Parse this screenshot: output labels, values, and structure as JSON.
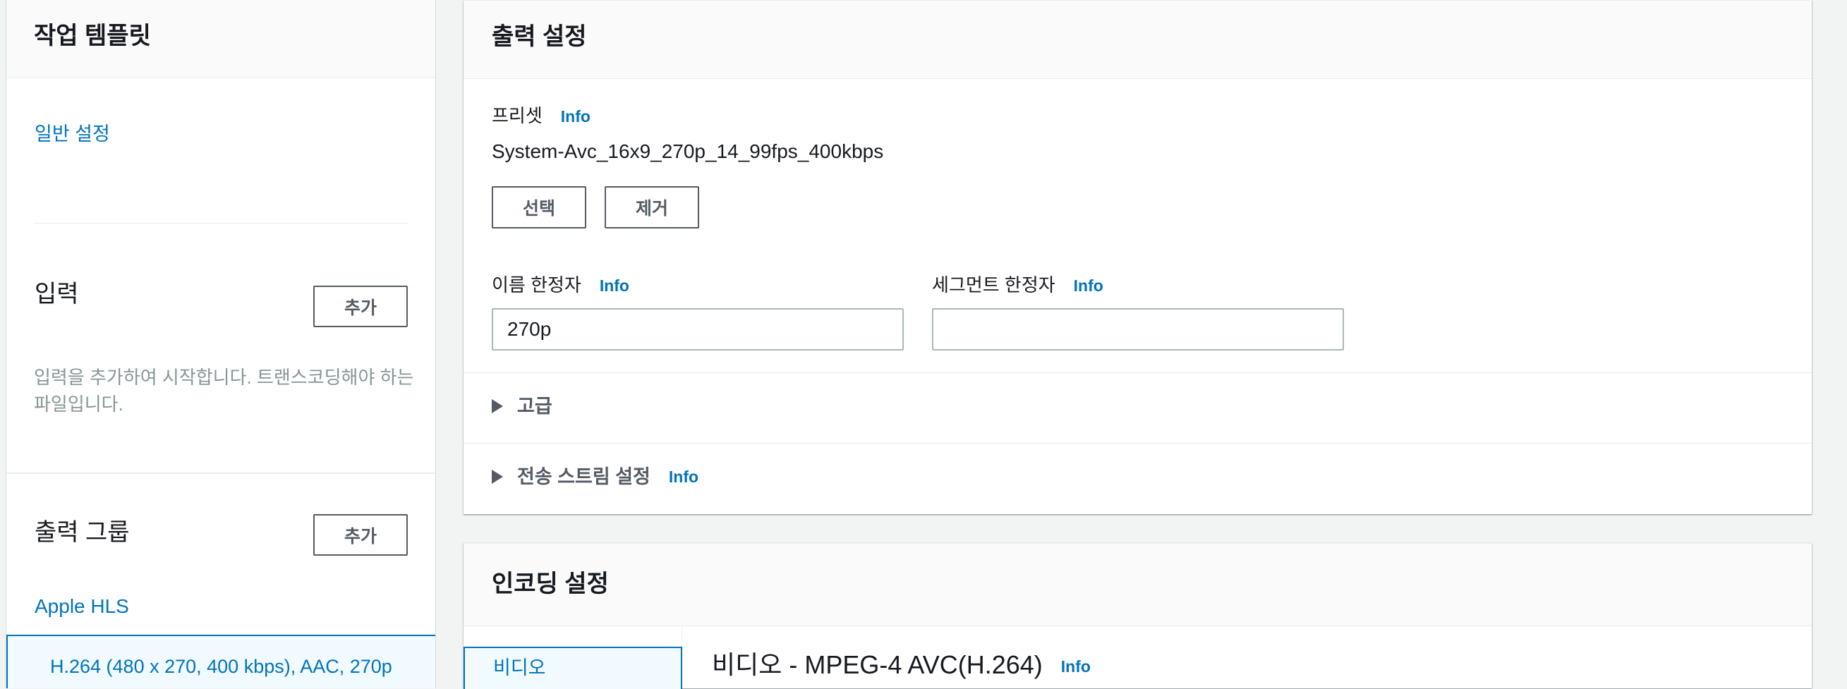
{
  "sidebar": {
    "title": "작업 템플릿",
    "general_settings_link": "일반 설정",
    "inputs": {
      "heading": "입력",
      "add_label": "추가",
      "help_text": "입력을 추가하여 시작합니다. 트랜스코딩해야 하는 파일입니다."
    },
    "output_groups": {
      "heading": "출력 그룹",
      "add_label": "추가",
      "group_name": "Apple HLS",
      "output_item": "H.264 (480 x 270, 400 kbps), AAC, 270p"
    }
  },
  "output_settings": {
    "title": "출력 설정",
    "preset": {
      "label": "프리셋",
      "info": "Info",
      "value": "System-Avc_16x9_270p_14_99fps_400kbps",
      "choose_label": "선택",
      "remove_label": "제거"
    },
    "name_modifier": {
      "label": "이름 한정자",
      "info": "Info",
      "value": "270p"
    },
    "segment_modifier": {
      "label": "세그먼트 한정자",
      "info": "Info",
      "value": ""
    },
    "advanced": {
      "label": "고급"
    },
    "transport_stream": {
      "label": "전송 스트림 설정",
      "info": "Info"
    }
  },
  "encoding_settings": {
    "title": "인코딩 설정",
    "tabs": [
      {
        "label": "비디오",
        "selected": true
      }
    ],
    "video_heading": "비디오 - MPEG-4 AVC(H.264)",
    "info": "Info"
  },
  "colors": {
    "link": "#0073bb",
    "button_border": "#545b64",
    "background": "#f2f3f3",
    "selected_bg": "#f1faff"
  },
  "icons": {
    "expander": "caret-right-icon"
  }
}
